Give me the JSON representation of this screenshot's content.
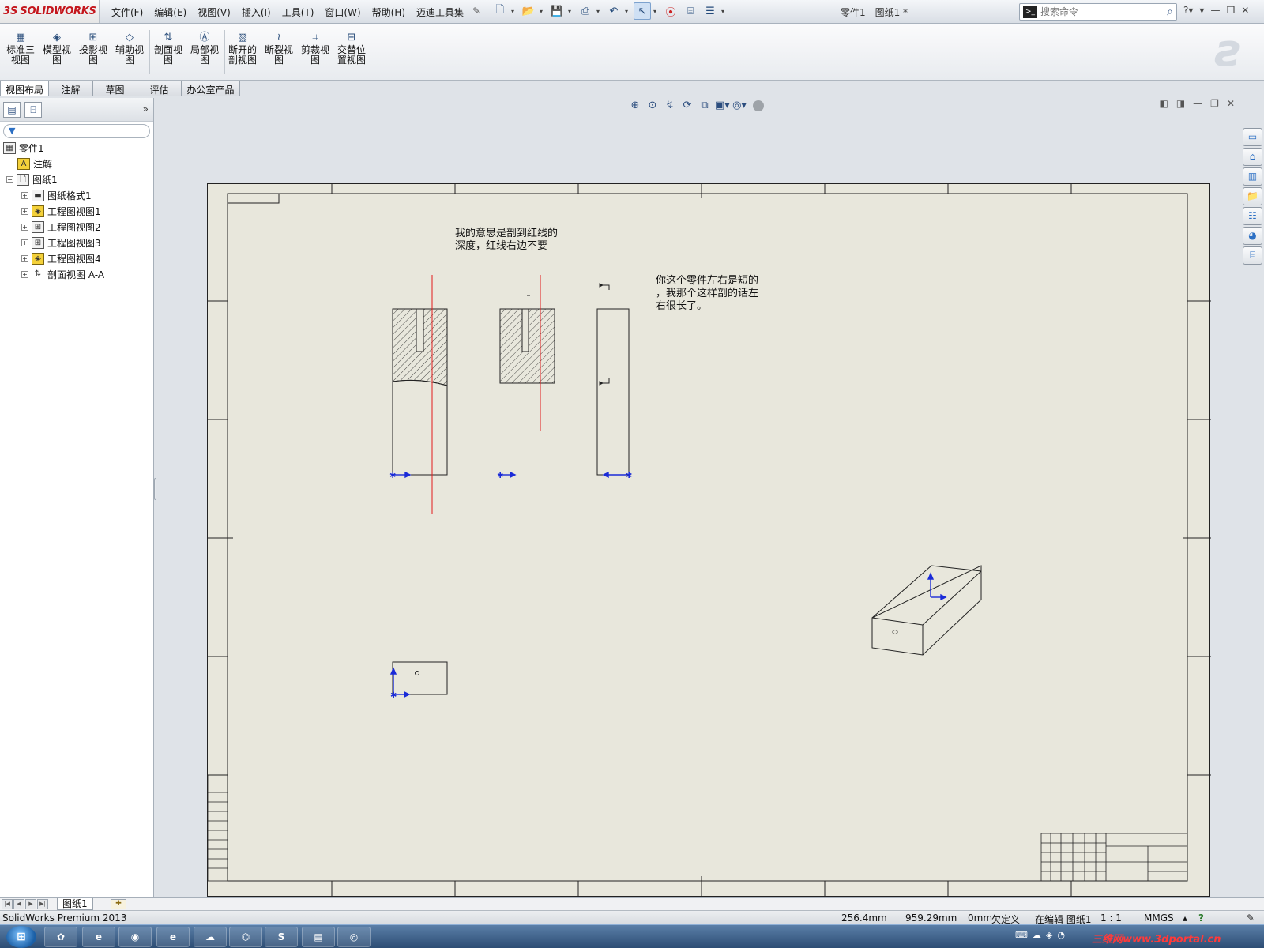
{
  "app": {
    "brand_mark": "3S",
    "brand_name": "SOLIDWORKS",
    "document_title": "零件1 - 图纸1 *"
  },
  "menu": [
    {
      "label": "文件(F)"
    },
    {
      "label": "编辑(E)"
    },
    {
      "label": "视图(V)"
    },
    {
      "label": "插入(I)"
    },
    {
      "label": "工具(T)"
    },
    {
      "label": "窗口(W)"
    },
    {
      "label": "帮助(H)"
    },
    {
      "label": "迈迪工具集"
    }
  ],
  "command_search": {
    "placeholder": "搜索命令"
  },
  "command_manager": [
    {
      "label": "标准三\n视图"
    },
    {
      "label": "模型视\n图"
    },
    {
      "label": "投影视\n图"
    },
    {
      "label": "辅助视\n图"
    },
    {
      "label": "剖面视\n图"
    },
    {
      "label": "局部视\n图"
    },
    {
      "label": "断开的\n剖视图"
    },
    {
      "label": "断裂视\n图"
    },
    {
      "label": "剪裁视\n图"
    },
    {
      "label": "交替位\n置视图"
    }
  ],
  "tabs": [
    {
      "label": "视图布局",
      "active": true
    },
    {
      "label": "注解"
    },
    {
      "label": "草图"
    },
    {
      "label": "评估"
    },
    {
      "label": "办公室产品"
    }
  ],
  "feature_tree": {
    "root": "零件1",
    "items": [
      {
        "label": "注解"
      },
      {
        "label": "图纸1"
      },
      {
        "label": "图纸格式1"
      },
      {
        "label": "工程图视图1"
      },
      {
        "label": "工程图视图2"
      },
      {
        "label": "工程图视图3"
      },
      {
        "label": "工程图视图4"
      },
      {
        "label": "剖面视图 A-A"
      }
    ]
  },
  "notes": {
    "note1": "我的意思是剖到红线的\n深度，红线右边不要",
    "note2": "你这个零件左右是短的\n，我那个这样剖的话左\n右很长了。"
  },
  "sheet_tabs": {
    "active": "图纸1"
  },
  "status": {
    "product": "SolidWorks Premium 2013",
    "x": "256.4mm",
    "y": "959.29mm",
    "z": "0mm",
    "state": "欠定义",
    "editing": "在编辑 图纸1",
    "scale": "1 : 1",
    "units": "MMGS"
  },
  "colors": {
    "sheet": "#e8e7dc",
    "red_line": "#e21b1b",
    "axis_blue": "#1a2bd8"
  },
  "taskbar": {
    "watermark": "三维网www.3dportal.cn"
  }
}
